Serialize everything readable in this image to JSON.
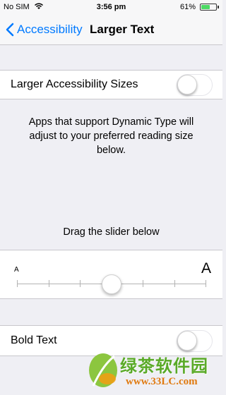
{
  "status_bar": {
    "carrier": "No SIM",
    "time": "3:56 pm",
    "battery_pct": "61%",
    "battery_level": 0.61
  },
  "nav": {
    "back_label": "Accessibility",
    "title": "Larger Text"
  },
  "larger_sizes": {
    "label": "Larger Accessibility Sizes",
    "on": false
  },
  "description": "Apps that support Dynamic Type will adjust to your preferred reading size below.",
  "slider": {
    "caption": "Drag the slider below",
    "small_label": "A",
    "large_label": "A",
    "steps": 7,
    "selected_index": 3
  },
  "bold_text": {
    "label": "Bold Text",
    "on": false
  },
  "watermark": {
    "text": "绿茶软件园",
    "url": "www.33LC.com"
  },
  "colors": {
    "accent": "#007aff",
    "toggle_off_border": "#e5e5ea",
    "battery": "#4cd964"
  }
}
